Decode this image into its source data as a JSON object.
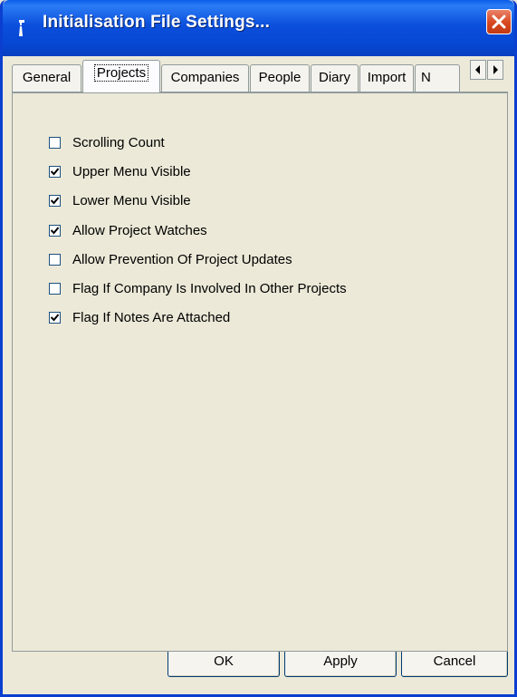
{
  "window": {
    "title": "Initialisation File Settings..."
  },
  "tabs": [
    {
      "label": "General",
      "active": false
    },
    {
      "label": "Projects",
      "active": true
    },
    {
      "label": "Companies",
      "active": false
    },
    {
      "label": "People",
      "active": false
    },
    {
      "label": "Diary",
      "active": false
    },
    {
      "label": "Import",
      "active": false
    },
    {
      "label": "N",
      "active": false
    }
  ],
  "options": [
    {
      "label": "Scrolling Count",
      "checked": false
    },
    {
      "label": "Upper Menu Visible",
      "checked": true
    },
    {
      "label": "Lower Menu Visible",
      "checked": true
    },
    {
      "label": "Allow Project Watches",
      "checked": true
    },
    {
      "label": "Allow Prevention Of Project Updates",
      "checked": false
    },
    {
      "label": "Flag If Company Is Involved In Other Projects",
      "checked": false
    },
    {
      "label": "Flag If Notes Are Attached",
      "checked": true
    }
  ],
  "buttons": {
    "ok": "OK",
    "apply": "Apply",
    "cancel": "Cancel"
  }
}
